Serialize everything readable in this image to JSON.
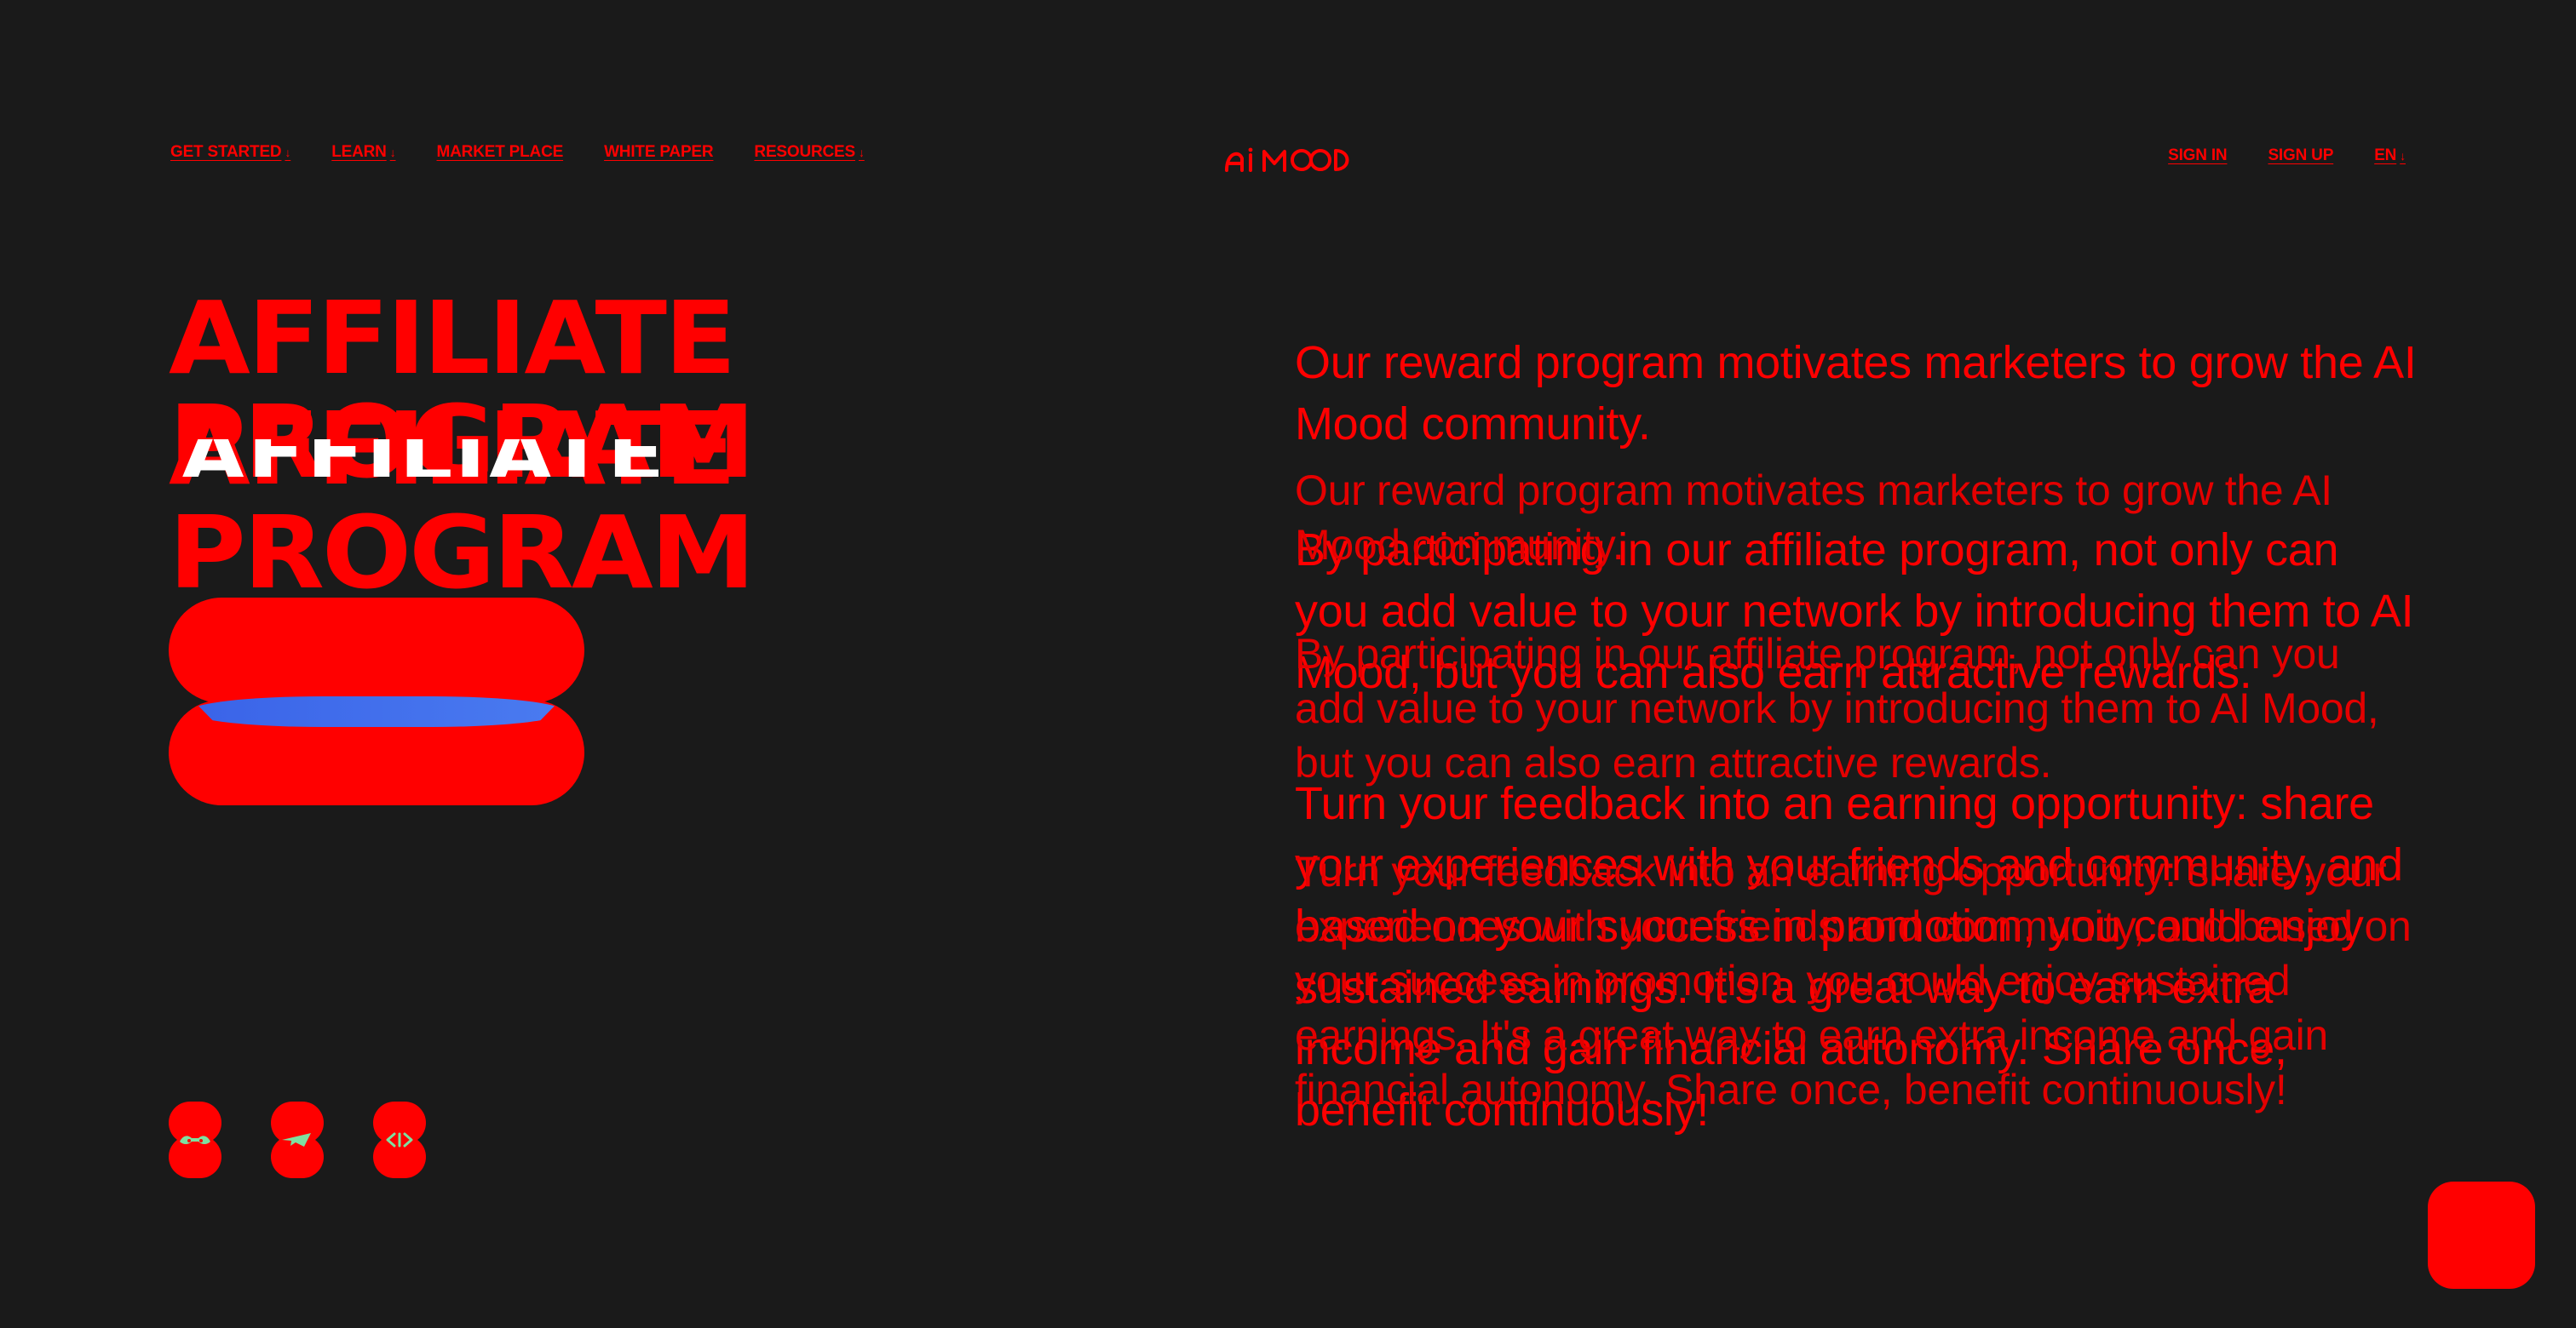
{
  "nav": {
    "left": [
      {
        "label": "GET STARTED",
        "caret": "↓"
      },
      {
        "label": "LEARN",
        "caret": "↓"
      },
      {
        "label": "MARKET PLACE",
        "caret": ""
      },
      {
        "label": "WHITE PAPER",
        "caret": ""
      },
      {
        "label": "RESOURCES",
        "caret": "↓"
      }
    ],
    "logo_text": "AI MOOD",
    "right": [
      {
        "label": "SIGN IN",
        "caret": ""
      },
      {
        "label": "SIGN UP",
        "caret": ""
      },
      {
        "label": "EN",
        "caret": "↓"
      }
    ]
  },
  "hero": {
    "title_line1": "AFFILIATE",
    "title_line2": "PROGRAM",
    "cta_label": ""
  },
  "content": {
    "p1": "Our reward program motivates marketers to grow the AI Mood community.",
    "p2": "By participating in our affiliate program, not only can you add value to your network by introducing them to AI Mood, but you can also earn attractive rewards.",
    "p3": "Turn your feedback into an earning opportunity: share your experiences with your friends and community, and based on your success in promotion, you could enjoy sustained earnings. It's a great way to earn extra income and gain financial autonomy. Share once, benefit continuously!"
  },
  "social": [
    {
      "icon": "discord-icon"
    },
    {
      "icon": "telegram-icon"
    },
    {
      "icon": "x-twitter-icon"
    }
  ],
  "colors": {
    "background": "#1a1a1a",
    "accent": "#ff0000",
    "cta_blue": "#3a63e8",
    "icon_green": "#7ee0a0"
  }
}
